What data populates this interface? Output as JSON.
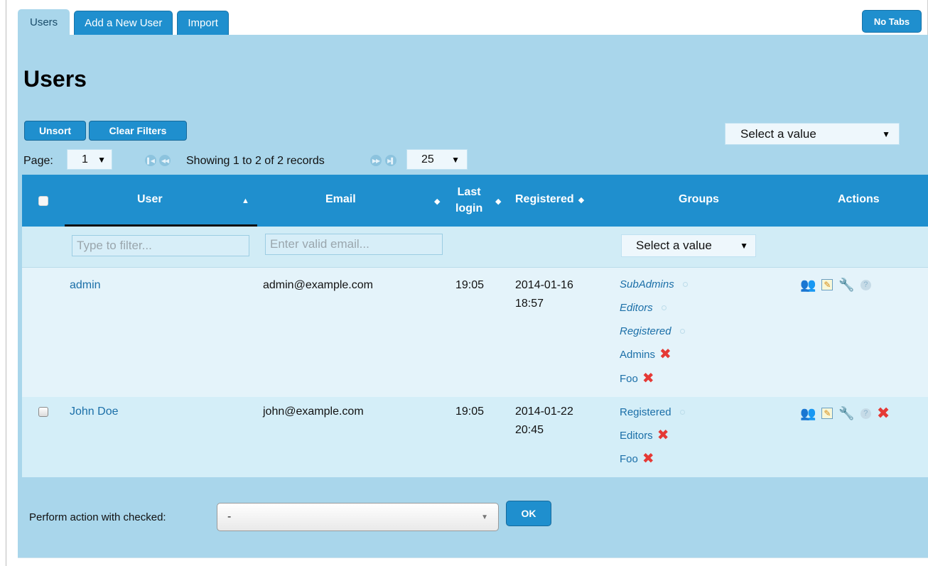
{
  "tabs": [
    {
      "label": "Users",
      "active": true
    },
    {
      "label": "Add a New User",
      "active": false
    },
    {
      "label": "Import",
      "active": false
    }
  ],
  "no_tabs_label": "No Tabs",
  "page_title": "Users",
  "toolbar": {
    "unsort_label": "Unsort",
    "clear_filters_label": "Clear Filters",
    "global_select_value": "Select a value"
  },
  "pager": {
    "page_label": "Page:",
    "current_page": "1",
    "showing_text": "Showing 1 to 2 of 2 records",
    "per_page": "25"
  },
  "columns": {
    "user": "User",
    "email": "Email",
    "last_login_1": "Last",
    "last_login_2": "login",
    "registered": "Registered",
    "groups": "Groups",
    "actions": "Actions"
  },
  "filters": {
    "user_placeholder": "Type to filter...",
    "email_placeholder": "Enter valid email...",
    "groups_select_value": "Select a value"
  },
  "rows": [
    {
      "user": "admin",
      "email": "admin@example.com",
      "last_login": "19:05",
      "registered_date": "2014-01-16",
      "registered_time": "18:57",
      "groups": [
        {
          "name": "SubAdmins",
          "italic": true,
          "removable": false
        },
        {
          "name": "Editors",
          "italic": true,
          "removable": false
        },
        {
          "name": "Registered",
          "italic": true,
          "removable": false
        },
        {
          "name": "Admins",
          "italic": false,
          "removable": true
        },
        {
          "name": "Foo",
          "italic": false,
          "removable": true
        }
      ],
      "actions": [
        "switch-user-icon",
        "edit-icon",
        "wrench-icon",
        "help-icon"
      ]
    },
    {
      "user": "John Doe",
      "email": "john@example.com",
      "last_login": "19:05",
      "registered_date": "2014-01-22",
      "registered_time": "20:45",
      "groups": [
        {
          "name": "Registered",
          "italic": false,
          "removable": false
        },
        {
          "name": "Editors",
          "italic": false,
          "removable": true
        },
        {
          "name": "Foo",
          "italic": false,
          "removable": true
        }
      ],
      "actions": [
        "switch-user-icon",
        "edit-icon",
        "wrench-icon",
        "help-icon",
        "delete-icon"
      ]
    }
  ],
  "bulk": {
    "label": "Perform action with checked:",
    "selected": "-",
    "ok_label": "OK"
  },
  "colors": {
    "accent": "#1f8fce",
    "panel": "#a9d6eb",
    "delete": "#e53935",
    "link": "#1b6fa8"
  }
}
